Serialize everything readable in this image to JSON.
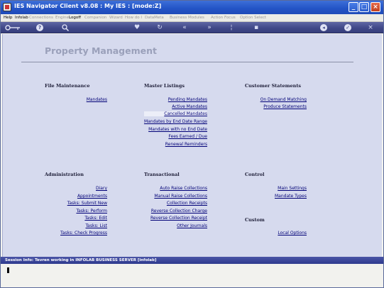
{
  "window": {
    "title": "IES Navigator Client v8.08 : My IES :      [mode:Z]",
    "minimize": "_",
    "maximize": "□",
    "close": "×"
  },
  "menu": {
    "items": [
      {
        "label": "Help",
        "dim": false
      },
      {
        "label": "Infolab",
        "dim": false
      },
      {
        "label": "Connections",
        "dim": true
      },
      {
        "label": "Engine",
        "dim": true
      },
      {
        "label": "Logoff",
        "dim": false
      },
      {
        "label": "Companion",
        "dim": true
      },
      {
        "label": "Wizard",
        "dim": true
      },
      {
        "label": "How do I",
        "dim": true
      },
      {
        "label": "DataMeta",
        "dim": true
      },
      {
        "label": "Business Modules",
        "dim": true
      },
      {
        "label": "Action Focus",
        "dim": true
      },
      {
        "label": "Option Select",
        "dim": true
      }
    ]
  },
  "toolbar": {
    "icons": [
      "key-icon",
      "help-icon",
      "search-icon",
      "heart-icon",
      "refresh-icon",
      "rewind-icon",
      "forward-icon",
      "info-icon",
      "list-icon",
      "back-icon",
      "check-icon",
      "close-icon"
    ]
  },
  "page": {
    "title": "Property Management"
  },
  "sections": {
    "file_maintenance": {
      "heading": "File Maintenance",
      "links": [
        "Mandates"
      ]
    },
    "master_listings": {
      "heading": "Master Listings",
      "links": [
        "Pending Mandates",
        "Active Mandates",
        "Cancelled Mandates",
        "Mandates by End Date Range",
        "Mandates with no End Date",
        "Fees Earned / Due",
        "Renewal Reminders"
      ]
    },
    "customer_statements": {
      "heading": "Customer Statements",
      "links": [
        "On Demand Matching",
        "Produce Statements"
      ]
    },
    "administration": {
      "heading": "Administration",
      "links": [
        "Diary",
        "Appointments",
        "Tasks: Submit New",
        "Tasks: Perform",
        "Tasks: Edit",
        "Tasks: List",
        "Tasks: Check Progress"
      ]
    },
    "transactional": {
      "heading": "Transactional",
      "links": [
        "Auto Raise Collections",
        "Manual Raise Collections",
        "Collection Receipts",
        "Reverse Collection Charge",
        "Reverse Collection Receipt",
        "Other Journals"
      ]
    },
    "control": {
      "heading": "Control",
      "links": [
        "Main Settings",
        "Mandate Types"
      ]
    },
    "custom": {
      "heading": "Custom",
      "links": [
        "Local Options"
      ]
    }
  },
  "status": {
    "text": "Session Info: Tevren working in INFOLAB BUSINESS SERVER  [infolab]"
  }
}
